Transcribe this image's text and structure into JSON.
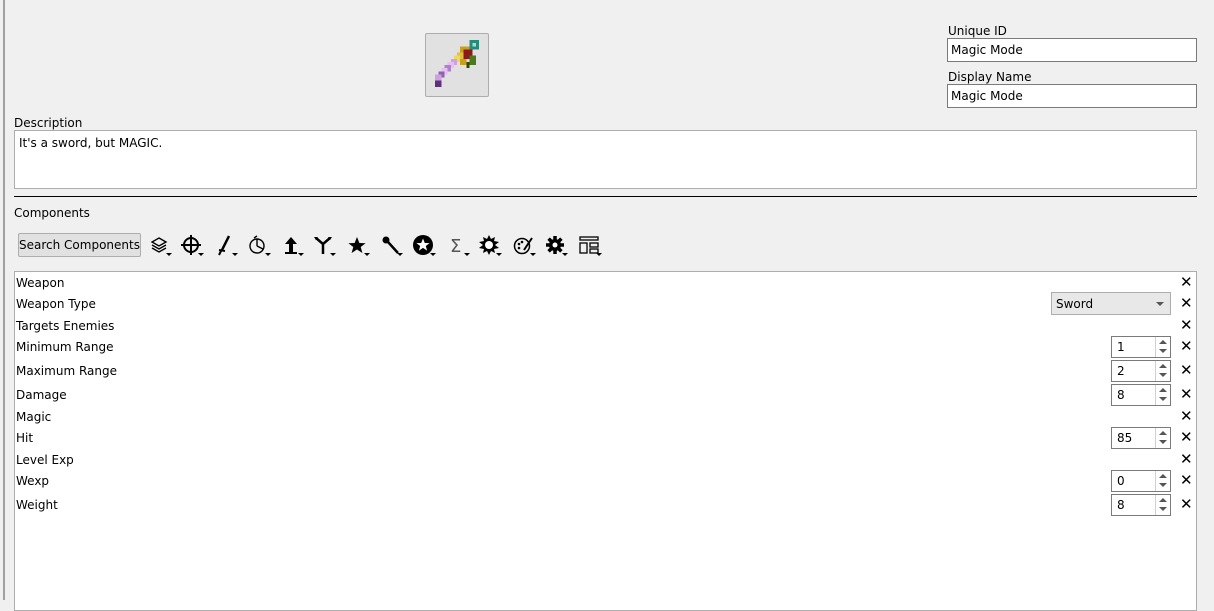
{
  "item": {
    "icon": "magic-sword-icon",
    "unique_id_label": "Unique ID",
    "unique_id_value": "Magic Mode",
    "display_name_label": "Display Name",
    "display_name_value": "Magic Mode",
    "description_label": "Description",
    "description_value": "It's a sword, but MAGIC."
  },
  "components": {
    "section_label": "Components",
    "search_button_label": "Search Components",
    "toolbar_icons": [
      "layers-icon",
      "crosshair-icon",
      "sword-icon",
      "pie-icon",
      "arrow-up-icon",
      "fork-icon",
      "star-icon",
      "wand-icon",
      "star-badge-icon",
      "sigma-icon",
      "burst-icon",
      "palette-icon",
      "gear-icon",
      "layout-icon"
    ],
    "rows": [
      {
        "label": "Weapon"
      },
      {
        "label": "Weapon Type",
        "combo": "Sword"
      },
      {
        "label": "Targets Enemies"
      },
      {
        "label": "Minimum Range",
        "spin": "1"
      },
      {
        "label": "Maximum Range",
        "spin": "2"
      },
      {
        "label": "Damage",
        "spin": "8"
      },
      {
        "label": "Magic"
      },
      {
        "label": "Hit",
        "spin": "85"
      },
      {
        "label": "Level Exp"
      },
      {
        "label": "Wexp",
        "spin": "0"
      },
      {
        "label": "Weight",
        "spin": "8"
      }
    ],
    "remove_glyph": "✕"
  }
}
